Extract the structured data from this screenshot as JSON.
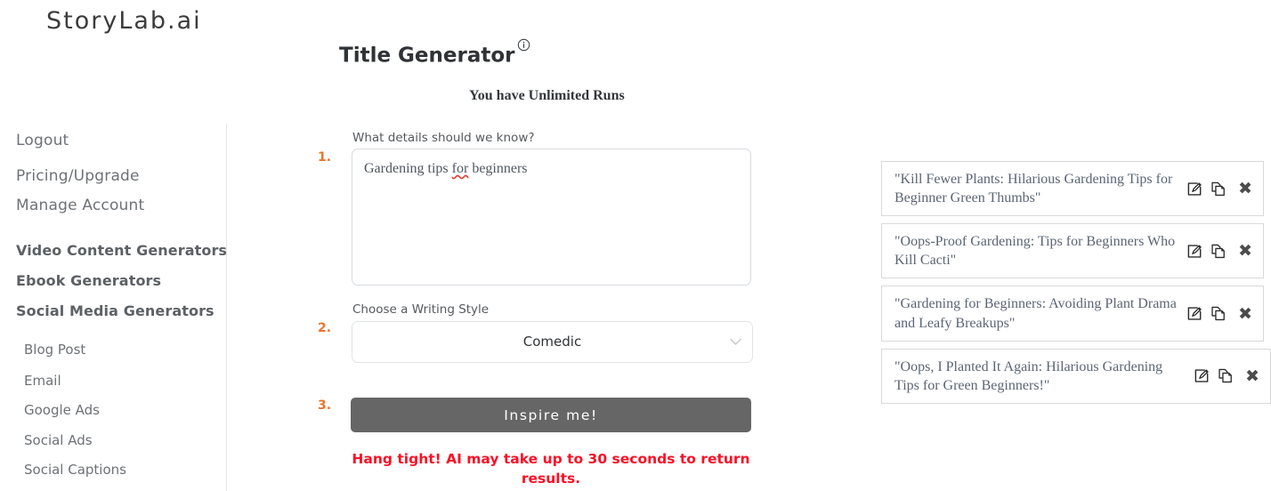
{
  "brand": {
    "logo": "StoryLab.ai"
  },
  "sidebar": {
    "top_links": [
      {
        "label": "Logout",
        "name": "sidebar-item-logout"
      },
      {
        "label": "Pricing/Upgrade",
        "name": "sidebar-item-pricing-upgrade"
      },
      {
        "label": "Manage Account",
        "name": "sidebar-item-manage-account"
      }
    ],
    "groups": [
      {
        "label": "Video Content Generators",
        "name": "sidebar-group-video-content-generators"
      },
      {
        "label": "Ebook Generators",
        "name": "sidebar-group-ebook-generators"
      },
      {
        "label": "Social Media Generators",
        "name": "sidebar-group-social-media-generators"
      }
    ],
    "sub_items": [
      {
        "label": "Blog Post",
        "name": "sidebar-item-blog-post"
      },
      {
        "label": "Email",
        "name": "sidebar-item-email"
      },
      {
        "label": "Google Ads",
        "name": "sidebar-item-google-ads"
      },
      {
        "label": "Social Ads",
        "name": "sidebar-item-social-ads"
      },
      {
        "label": "Social Captions",
        "name": "sidebar-item-social-captions"
      }
    ]
  },
  "header": {
    "title": "Title Generator",
    "info_icon": "info-circle-icon",
    "runs_note": "You have Unlimited Runs"
  },
  "form": {
    "step1_number": "1.",
    "step2_number": "2.",
    "step3_number": "3.",
    "details_label": "What details should we know?",
    "details_value": "Gardening tips for beginners",
    "details_value_part1": "Gardening tips ",
    "details_value_misspelled": "for",
    "details_value_part2": " beginners",
    "details_placeholder": "",
    "style_label": "Choose a Writing Style",
    "style_value": "Comedic",
    "style_options": [
      "Comedic"
    ],
    "chevron_icon": "chevron-down-icon",
    "submit_label": "Inspire me!",
    "warning": "Hang tight! AI may take up to 30 seconds to return results."
  },
  "results": {
    "items": [
      {
        "text": "\"Kill Fewer Plants: Hilarious Gardening Tips for Beginner Green Thumbs\"",
        "edit_icon": "edit-pencil-icon",
        "copy_icon": "copy-icon",
        "delete_icon": "close-x-icon"
      },
      {
        "text": "\"Oops-Proof Gardening: Tips for Beginners Who Kill Cacti\"",
        "edit_icon": "edit-pencil-icon",
        "copy_icon": "copy-icon",
        "delete_icon": "close-x-icon"
      },
      {
        "text": "\"Gardening for Beginners: Avoiding Plant Drama and Leafy Breakups\"",
        "edit_icon": "edit-pencil-icon",
        "copy_icon": "copy-icon",
        "delete_icon": "close-x-icon"
      },
      {
        "text": "\"Oops, I Planted It Again: Hilarious Gardening Tips for Green Beginners!\"",
        "edit_icon": "edit-pencil-icon",
        "copy_icon": "copy-icon",
        "delete_icon": "close-x-icon"
      }
    ],
    "delete_glyph": "✖"
  },
  "colors": {
    "accent_orange": "#e8762c",
    "warning_red": "#fa1026",
    "button_gray": "#666666",
    "result_text": "#5a6575"
  }
}
